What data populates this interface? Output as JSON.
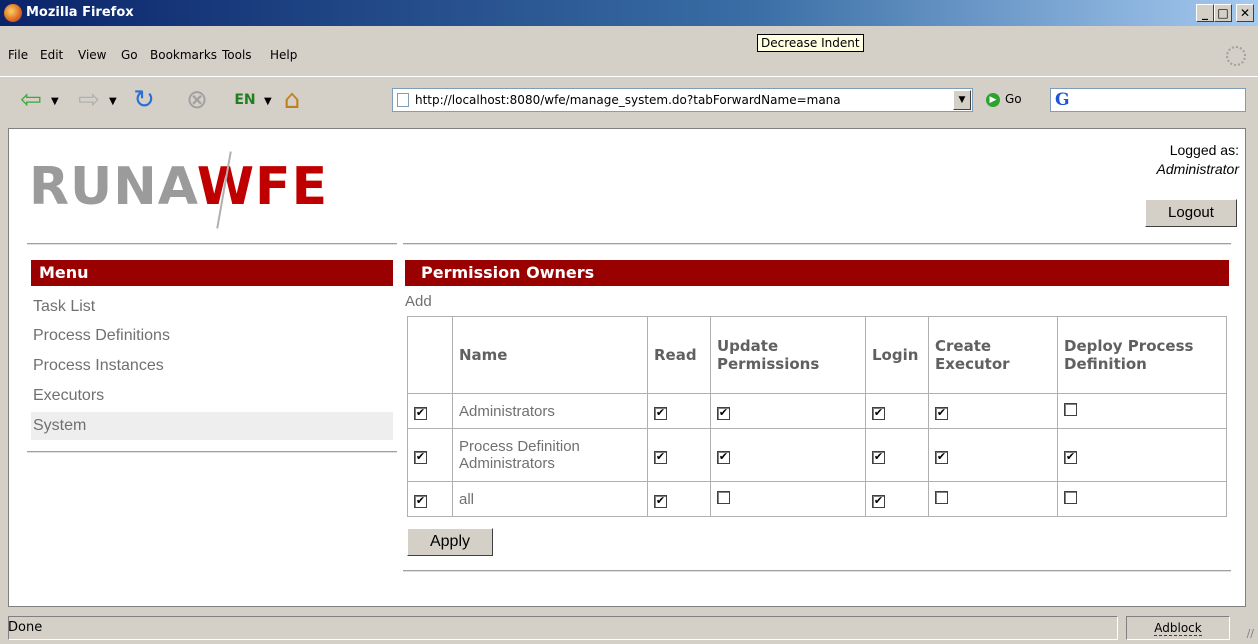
{
  "window": {
    "title": "Mozilla Firefox",
    "minimize": "_",
    "maximize": "□",
    "close": "✕"
  },
  "tooltip": "Decrease Indent",
  "menubar": [
    "File",
    "Edit",
    "View",
    "Go",
    "Bookmarks",
    "Tools",
    "Help"
  ],
  "toolbar": {
    "url": "http://localhost:8080/wfe/manage_system.do?tabForwardName=mana",
    "go_label": "Go",
    "google_letter": "G"
  },
  "header": {
    "logo_left": "RUNA",
    "logo_right": "WFE",
    "logged_label": "Logged as:",
    "logged_user": "Administrator",
    "logout_label": "Logout"
  },
  "menu": {
    "title": "Menu",
    "items": [
      "Task List",
      "Process Definitions",
      "Process Instances",
      "Executors",
      "System"
    ],
    "selected": "System"
  },
  "permissions": {
    "title": "Permission Owners",
    "add_label": "Add",
    "columns": [
      "",
      "Name",
      "Read",
      "Update Permissions",
      "Login",
      "Create Executor",
      "Deploy Process Definition"
    ],
    "rows": [
      {
        "selected": true,
        "name": "Administrators",
        "read": true,
        "update": true,
        "login": true,
        "create": true,
        "deploy": false
      },
      {
        "selected": true,
        "name": "Process Definition Administrators",
        "read": true,
        "update": true,
        "login": true,
        "create": true,
        "deploy": true
      },
      {
        "selected": true,
        "name": "all",
        "read": true,
        "update": false,
        "login": true,
        "create": false,
        "deploy": false
      }
    ],
    "apply_label": "Apply"
  },
  "status": {
    "text": "Done",
    "adblock": "Adblock"
  }
}
